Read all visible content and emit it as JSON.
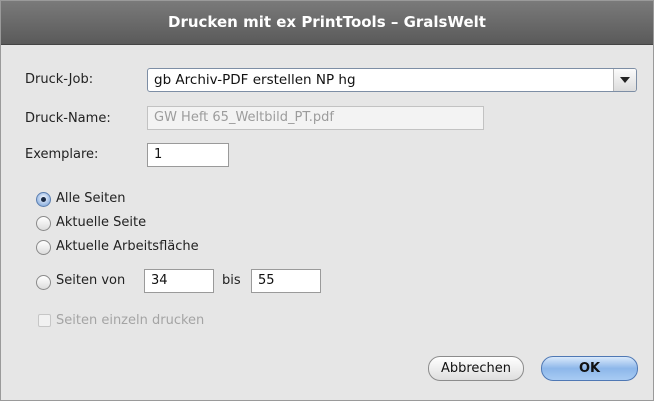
{
  "dialog": {
    "title": "Drucken mit ex PrintTools – GralsWelt"
  },
  "job": {
    "label": "Druck-Job:",
    "selected": "gb Archiv-PDF erstellen NP hg"
  },
  "name": {
    "label": "Druck-Name:",
    "value": "GW Heft 65_Weltbild_PT.pdf"
  },
  "copies": {
    "label": "Exemplare:",
    "value": "1"
  },
  "pages": {
    "options": [
      {
        "label": "Alle Seiten",
        "selected": true
      },
      {
        "label": "Aktuelle Seite",
        "selected": false
      },
      {
        "label": "Aktuelle Arbeitsfläche",
        "selected": false
      },
      {
        "label": "Seiten von",
        "selected": false
      }
    ],
    "from": "34",
    "to_label": "bis",
    "to": "55"
  },
  "single_pages": {
    "label": "Seiten einzeln drucken",
    "checked": false,
    "enabled": false
  },
  "buttons": {
    "cancel": "Abbrechen",
    "ok": "OK"
  }
}
